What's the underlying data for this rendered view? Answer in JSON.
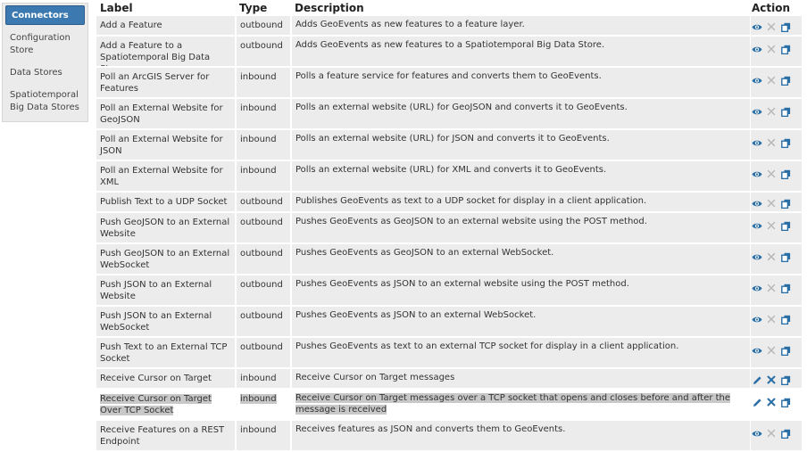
{
  "sidebar": {
    "items": [
      {
        "label": "Connectors",
        "active": true
      },
      {
        "label": "Configuration Store"
      },
      {
        "label": "Data Stores"
      },
      {
        "label": "Spatiotemporal Big Data Stores"
      }
    ]
  },
  "table": {
    "headers": {
      "label": "Label",
      "type": "Type",
      "description": "Description",
      "action": "Action"
    },
    "rows": [
      {
        "label": "Add a Feature",
        "type": "outbound",
        "description": "Adds GeoEvents as new features to a feature layer."
      },
      {
        "label": "Add a Feature to a Spatiotemporal Big Data Store",
        "type": "outbound",
        "description": "Adds GeoEvents as new features to a Spatiotemporal Big Data Store."
      },
      {
        "label": "Poll an ArcGIS Server for Features",
        "type": "inbound",
        "description": "Polls a feature service for features and converts them to GeoEvents."
      },
      {
        "label": "Poll an External Website for GeoJSON",
        "type": "inbound",
        "description": "Polls an external website (URL) for GeoJSON and converts it to GeoEvents."
      },
      {
        "label": "Poll an External Website for JSON",
        "type": "inbound",
        "description": "Polls an external website (URL) for JSON and converts it to GeoEvents."
      },
      {
        "label": "Poll an External Website for XML",
        "type": "inbound",
        "description": "Polls an external website (URL) for XML and converts it to GeoEvents."
      },
      {
        "label": "Publish Text to a UDP Socket",
        "type": "outbound",
        "description": "Publishes GeoEvents as text to a UDP socket for display in a client application."
      },
      {
        "label": "Push GeoJSON to an External Website",
        "type": "outbound",
        "description": "Pushes GeoEvents as GeoJSON to an external website using the POST method."
      },
      {
        "label": "Push GeoJSON to an External WebSocket",
        "type": "outbound",
        "description": "Pushes GeoEvents as GeoJSON to an external WebSocket."
      },
      {
        "label": "Push JSON to an External Website",
        "type": "outbound",
        "description": "Pushes GeoEvents as JSON to an external website using the POST method."
      },
      {
        "label": "Push JSON to an External WebSocket",
        "type": "outbound",
        "description": "Pushes GeoEvents as JSON to an external WebSocket."
      },
      {
        "label": "Push Text to an External TCP Socket",
        "type": "outbound",
        "description": "Pushes GeoEvents as text to an external TCP socket for display in a client application."
      },
      {
        "label": "Receive Cursor on Target",
        "type": "inbound",
        "description": "Receive Cursor on Target messages"
      },
      {
        "label": "Receive Cursor on Target Over TCP Socket",
        "type": "inbound",
        "description": "Receive Cursor on Target messages over a TCP socket that opens and closes before and after the message is received"
      },
      {
        "label": "Receive Features on a REST Endpoint",
        "type": "inbound",
        "description": "Receives features as JSON and converts them to GeoEvents."
      }
    ]
  },
  "icons": {
    "view": "eye-icon",
    "edit": "pencil-icon",
    "delete": "close-icon",
    "copy": "copy-icon"
  },
  "colors": {
    "accent": "#3c79b0",
    "icon_blue": "#2a6ea6",
    "icon_gray": "#b5b5b5"
  }
}
